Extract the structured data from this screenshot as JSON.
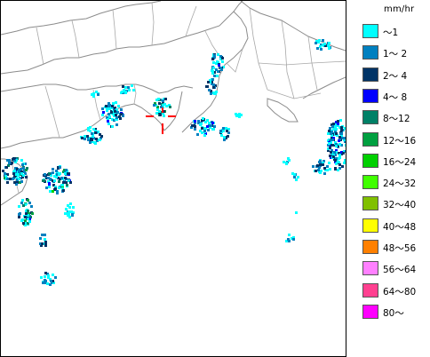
{
  "legend": {
    "unit": "mm/hr",
    "items": [
      {
        "label": "～1",
        "color": "#00ffff"
      },
      {
        "label": "1～ 2",
        "color": "#0080c0"
      },
      {
        "label": "2～ 4",
        "color": "#003366"
      },
      {
        "label": "4～ 8",
        "color": "#0000ff"
      },
      {
        "label": "8～12",
        "color": "#008066"
      },
      {
        "label": "12～16",
        "color": "#00a040"
      },
      {
        "label": "16～24",
        "color": "#00d000"
      },
      {
        "label": "24～32",
        "color": "#40ff00"
      },
      {
        "label": "32～40",
        "color": "#80c000"
      },
      {
        "label": "40～48",
        "color": "#ffff00"
      },
      {
        "label": "48～56",
        "color": "#ff8000"
      },
      {
        "label": "56～64",
        "color": "#ff80ff"
      },
      {
        "label": "64～80",
        "color": "#ff4090"
      },
      {
        "label": "80～",
        "color": "#ff00ff"
      }
    ]
  },
  "colors": {
    "coastline": "#8c8c8c",
    "prefecture_border": "#a8a8a8",
    "location_marker": "#ff0000",
    "map_border": "#000000"
  }
}
